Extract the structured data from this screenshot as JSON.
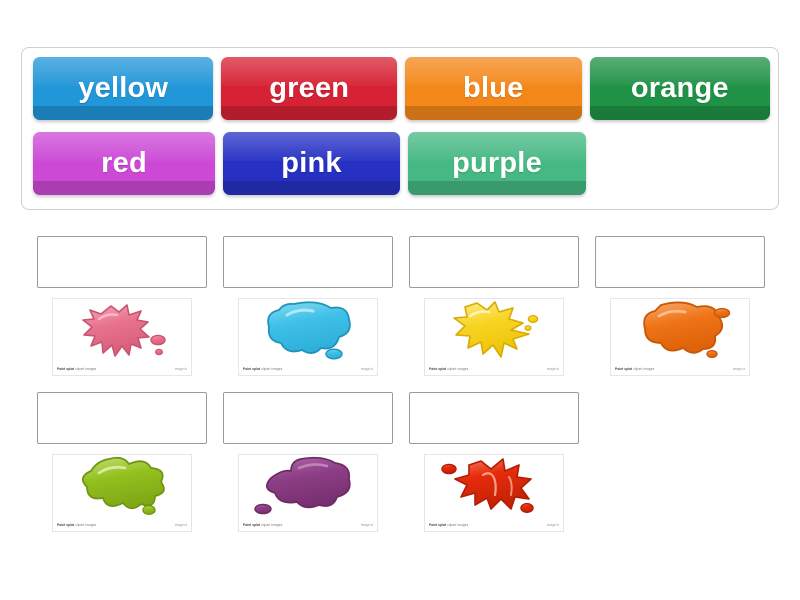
{
  "activity": {
    "type": "drag-and-drop-labelling",
    "word_bank": {
      "rows": [
        [
          {
            "label": "yellow",
            "tile_color": "#2196d8",
            "tile_color_dark": "#1b7fb8"
          },
          {
            "label": "green",
            "tile_color": "#d62234",
            "tile_color_dark": "#b01a29"
          },
          {
            "label": "blue",
            "tile_color": "#f4871a",
            "tile_color_dark": "#d96f0c"
          },
          {
            "label": "orange",
            "tile_color": "#1f9246",
            "tile_color_dark": "#177037"
          }
        ],
        [
          {
            "label": "red",
            "tile_color": "#cc49d6",
            "tile_color_dark": "#a935b3"
          },
          {
            "label": "pink",
            "tile_color": "#2631c4",
            "tile_color_dark": "#1c2699"
          },
          {
            "label": "purple",
            "tile_color": "#45b883",
            "tile_color_dark": "#349468"
          }
        ]
      ]
    },
    "answer_grid": {
      "rows": [
        [
          {
            "drop_zone_value": "",
            "image": {
              "name": "pink-paint-splat",
              "splat_color": "#e8738f",
              "splat_shade": "#c9546f",
              "highlight": "#f6a8bb",
              "caption_bold": "Paint splat",
              "caption_text": "clipart images",
              "caption_right": "image  id"
            }
          },
          {
            "drop_zone_value": "",
            "image": {
              "name": "blue-paint-splat",
              "splat_color": "#3fc0e8",
              "splat_shade": "#28a2c9",
              "highlight": "#86dbf3",
              "caption_bold": "Paint splat",
              "caption_text": "clipart images",
              "caption_right": "image  id"
            }
          },
          {
            "drop_zone_value": "",
            "image": {
              "name": "yellow-paint-splat",
              "splat_color": "#f8d524",
              "splat_shade": "#e0b706",
              "highlight": "#fdeb8e",
              "caption_bold": "Paint splat",
              "caption_text": "clipart images",
              "caption_right": "image  id"
            }
          },
          {
            "drop_zone_value": "",
            "image": {
              "name": "orange-paint-splat",
              "splat_color": "#ef7518",
              "splat_shade": "#d35c06",
              "highlight": "#f8ab6b",
              "caption_bold": "Paint splat",
              "caption_text": "clipart images",
              "caption_right": "image  id"
            }
          }
        ],
        [
          {
            "drop_zone_value": "",
            "image": {
              "name": "green-paint-splat",
              "splat_color": "#93c01f",
              "splat_shade": "#789d13",
              "highlight": "#c3e073",
              "caption_bold": "Paint splat",
              "caption_text": "clipart images",
              "caption_right": "image  id"
            }
          },
          {
            "drop_zone_value": "",
            "image": {
              "name": "purple-paint-splat",
              "splat_color": "#8d3e86",
              "splat_shade": "#6f2c69",
              "highlight": "#b06aa8",
              "caption_bold": "Paint splat",
              "caption_text": "clipart images",
              "caption_right": "image  id"
            }
          },
          {
            "drop_zone_value": "",
            "image": {
              "name": "red-paint-splat",
              "splat_color": "#e62c0c",
              "splat_shade": "#bd2007",
              "highlight": "#f87a5e",
              "caption_bold": "Paint splat",
              "caption_text": "clipart images",
              "caption_right": "image  id"
            }
          }
        ]
      ]
    }
  }
}
